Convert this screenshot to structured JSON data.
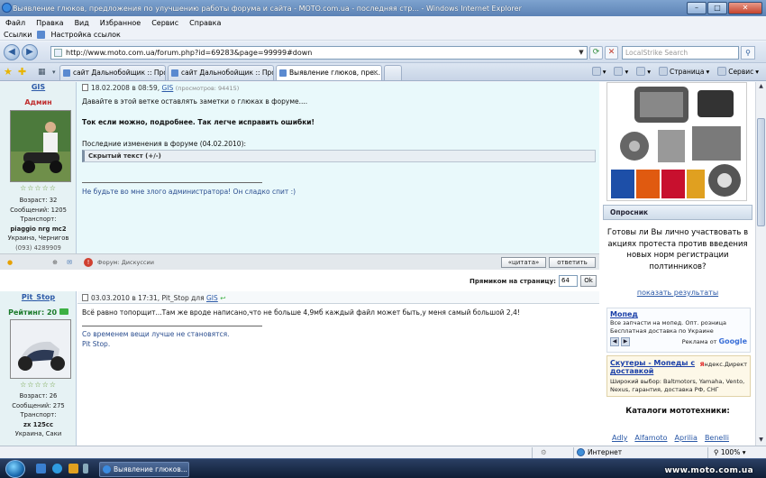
{
  "window": {
    "title": "Выявление глюков, предложения по улучшению работы форума и сайта - MOTO.com.ua - последняя стр... - Windows Internet Explorer"
  },
  "menu": [
    "Файл",
    "Правка",
    "Вид",
    "Избранное",
    "Сервис",
    "Справка"
  ],
  "links_bar": {
    "label": "Ссылки",
    "item": "Настройка ссылок"
  },
  "address": {
    "url": "http://www.moto.com.ua/forum.php?id=69283&page=99999#down"
  },
  "search": {
    "placeholder": "LocalStrike Search"
  },
  "tabs": [
    {
      "label": "сайт Дальнобойщик :: Про..."
    },
    {
      "label": "сайт Дальнобойщик :: Про..."
    },
    {
      "label": "Выявление глюков, пре..."
    }
  ],
  "command_bar": {
    "page": "Страница",
    "tools": "Сервис"
  },
  "post1": {
    "user": "GIS",
    "role": "Админ",
    "stars": "☆☆☆☆☆",
    "info": {
      "age": "Возраст: 32",
      "messages": "Сообщений: 1205",
      "transport_label": "Транспорт:",
      "transport": "piaggio nrg mc2",
      "location": "Украина, Чернигов",
      "phone": "(093) 4289909"
    },
    "header": {
      "date": "18.02.2008 в 08:59,",
      "author": "GIS",
      "views": "(просмотров: 94415)"
    },
    "text1": "Давайте в этой ветке оставлять заметки о глюках в форуме....",
    "text2": "Ток если можно, подробнее. Так легче исправить ошибки!",
    "text3": "Последние изменения в форуме (04.02.2010):",
    "spoiler": "Скрытый текст (+/-)",
    "signature": "Не будьте во мне злого администратора! Он сладко спит :)",
    "forum_label": "Форум: Дискуссии",
    "quote_btn": "«цитата»",
    "reply_btn": "ответить"
  },
  "jump": {
    "label": "Прямиком на страницу:",
    "value": "64",
    "ok": "Ok"
  },
  "post2": {
    "user": "Pit_Stop",
    "rating": "Рейтинг: 20",
    "stars": "☆☆☆☆☆",
    "info": {
      "age": "Возраст: 26",
      "messages": "Сообщений: 275",
      "transport_label": "Транспорт:",
      "transport": "zx 125cc",
      "location": "Украина, Саки"
    },
    "header": {
      "date": "03.03.2010 в 17:31,",
      "author": "Pit_Stop",
      "for": "для",
      "to": "GIS"
    },
    "text1": "Всё равно топорщит...Там же вроде написано,что не больше 4,9мб каждый файл может быть,у меня самый большой 2,4!",
    "sig1": "Со временем вещи лучше не становятся.",
    "sig2": "Pit Stop."
  },
  "sidebar": {
    "poll": {
      "header": "Опросник",
      "question": "Готовы ли Вы лично участвовать в акциях протеста против введения новых норм регистрации полтинников?",
      "results": "показать результаты"
    },
    "ad1": {
      "title": "Мопед",
      "desc": "Все запчасти на мопед. Опт. розница Бесплатная доставка по Украине",
      "by_label": "Реклама от",
      "by_brand": "Google"
    },
    "ad2": {
      "title": "Скутеры - Мопеды с доставкой",
      "desc": "Широкий выбор: Baltmotors, Yamaha, Vento, Nexus, гарантия, доставка РФ, СНГ",
      "yd_brand": "Я",
      "yd_rest": "ндекс.Директ"
    },
    "catalog": {
      "header": "Каталоги мототехники:",
      "links": [
        "Adly",
        "Alfamoto",
        "Aprilia",
        "Benelli"
      ]
    }
  },
  "status": {
    "zone": "Интернет",
    "zoom": "100%"
  },
  "taskbar": {
    "button": "Выявление глюков..."
  },
  "watermark": "www.moto.com.ua",
  "colors": {
    "post_bg": "#e9f9fb",
    "link": "#2b59a7",
    "admin": "#c03030"
  }
}
